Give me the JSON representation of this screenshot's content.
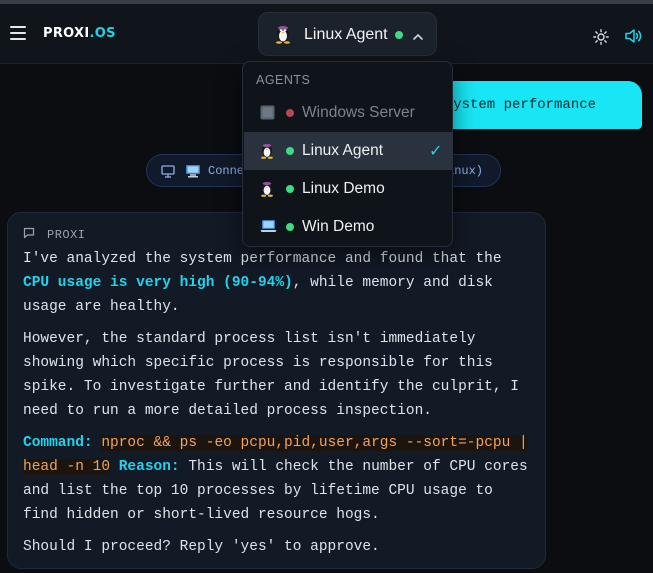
{
  "header": {
    "brand_a": "PROXI",
    "brand_b": ".OS",
    "current_agent": "Linux Agent",
    "icons": [
      "menu-icon",
      "tux-icon",
      "chevron-up-icon",
      "sun-icon",
      "speaker-icon"
    ]
  },
  "chat": {
    "user_message_visible": "e system performance",
    "connection_left": "Conne",
    "connection_right": "inux)",
    "assistant_label": "PROXI",
    "p1_a": "I've analyzed the system performance and found that the ",
    "p1_hl": "CPU usage is very high (90-94%)",
    "p1_b": ", while memory and disk usage are healthy.",
    "p2": "However, the standard process list isn't immediately showing which specific process is responsible for this spike. To investigate further and identify the culprit, I need to run a more detailed process inspection.",
    "cmd_label": "Command:",
    "cmd": "nproc && ps -eo pcpu,pid,user,args --sort=-pcpu | head -n 10",
    "reason_label": "Reason:",
    "reason": "This will check the number of CPU cores and list the top 10 processes by lifetime CPU usage to find hidden or short-lived resource hogs.",
    "p4": "Should I proceed? Reply 'yes' to approve."
  },
  "dropdown": {
    "heading": "AGENTS",
    "options": [
      {
        "name": "Windows Server",
        "status_color": "#b9474f",
        "icon": "windows-server-icon",
        "selected": false
      },
      {
        "name": "Linux Agent",
        "status_color": "#3ddc84",
        "icon": "tux-icon",
        "selected": true
      },
      {
        "name": "Linux Demo",
        "status_color": "#3ddc84",
        "icon": "tux-icon",
        "selected": false
      },
      {
        "name": "Win Demo",
        "status_color": "#3ddc84",
        "icon": "laptop-icon",
        "selected": false
      }
    ],
    "check": "✓"
  },
  "colors": {
    "accent": "#22d3ee",
    "online": "#3ddc84",
    "offline": "#b9474f",
    "code": "#f0a35e"
  }
}
